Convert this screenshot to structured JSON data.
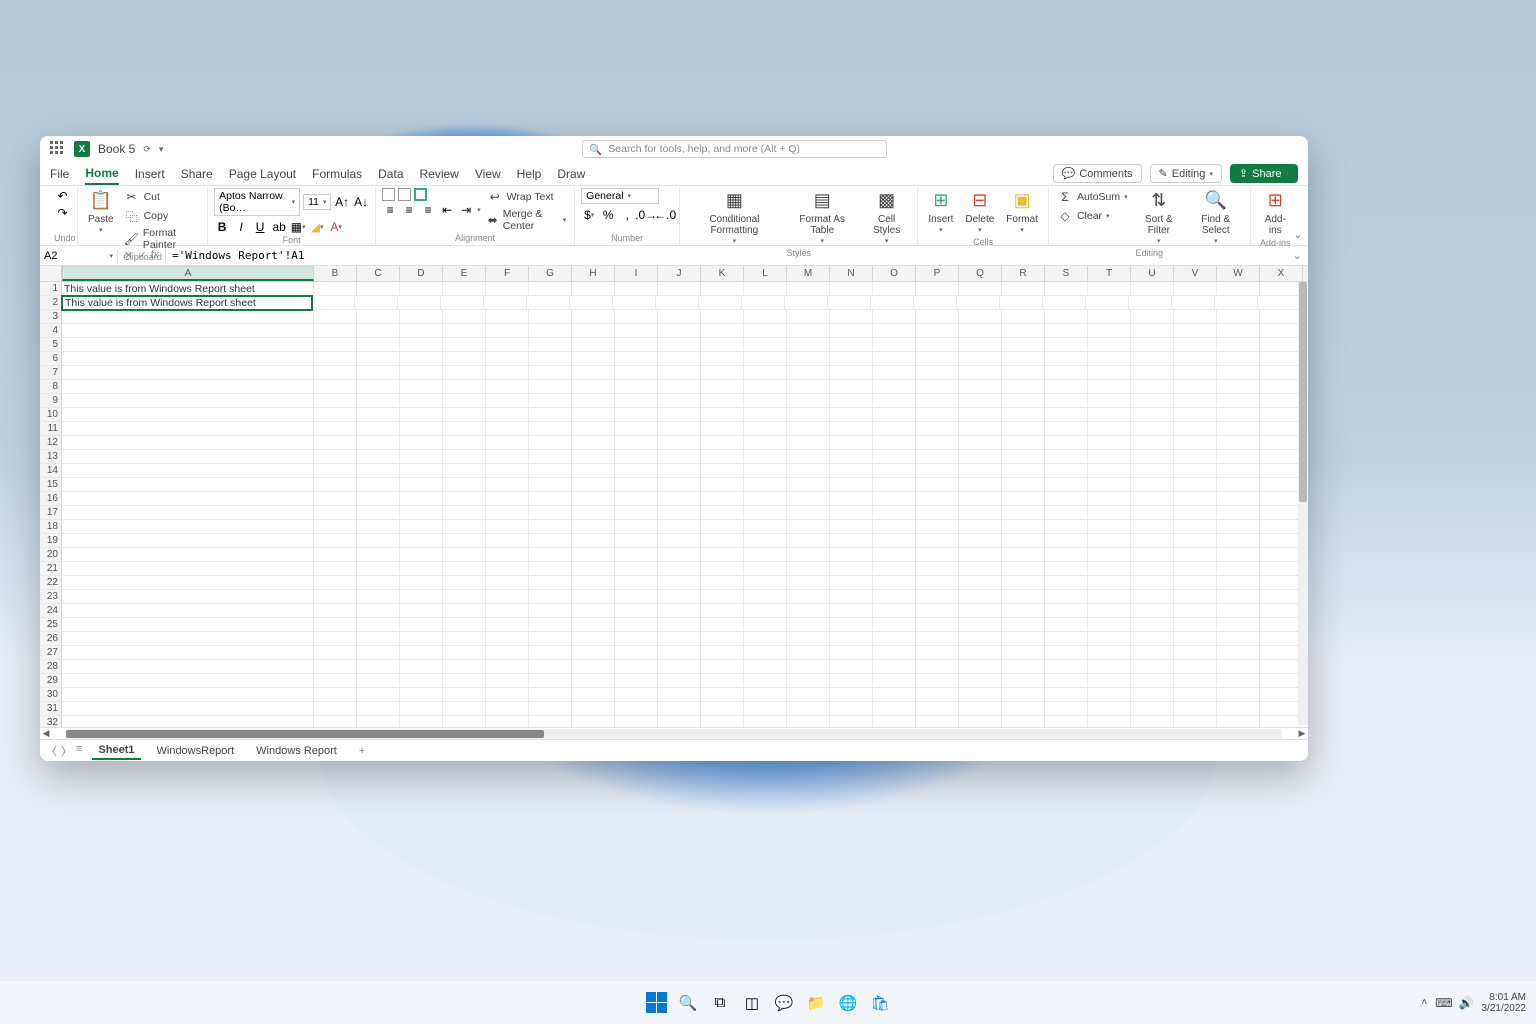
{
  "title": "Book 5",
  "search_placeholder": "Search for tools, help, and more (Alt + Q)",
  "menus": [
    "File",
    "Home",
    "Insert",
    "Share",
    "Page Layout",
    "Formulas",
    "Data",
    "Review",
    "View",
    "Help",
    "Draw"
  ],
  "active_menu": "Home",
  "right_pills": {
    "comments": "Comments",
    "editing": "Editing",
    "share": "Share"
  },
  "ribbon": {
    "undo": "Undo",
    "clipboard": {
      "paste": "Paste",
      "cut": "Cut",
      "copy": "Copy",
      "painter": "Format Painter",
      "label": "Clipboard"
    },
    "font": {
      "name": "Aptos Narrow (Bo…",
      "size": "11",
      "label": "Font"
    },
    "alignment": {
      "wrap": "Wrap Text",
      "merge": "Merge & Center",
      "label": "Alignment"
    },
    "number": {
      "format": "General",
      "label": "Number"
    },
    "styles": {
      "cond": "Conditional Formatting",
      "table": "Format As Table",
      "cell": "Cell Styles",
      "label": "Styles"
    },
    "cells": {
      "insert": "Insert",
      "delete": "Delete",
      "format": "Format",
      "label": "Cells"
    },
    "editing": {
      "autosum": "AutoSum",
      "clear": "Clear",
      "sort": "Sort & Filter",
      "find": "Find & Select",
      "label": "Editing"
    },
    "addins": {
      "btn": "Add-ins",
      "label": "Add-ins"
    }
  },
  "formula_bar": {
    "cell_ref": "A2",
    "formula": "='Windows Report'!A1"
  },
  "columns": [
    "A",
    "B",
    "C",
    "D",
    "E",
    "F",
    "G",
    "H",
    "I",
    "J",
    "K",
    "L",
    "M",
    "N",
    "O",
    "P",
    "Q",
    "R",
    "S",
    "T",
    "U",
    "V",
    "W",
    "X"
  ],
  "col_widths": {
    "A": 252,
    "default": 43
  },
  "row_count": 32,
  "active_cell": {
    "row": 2,
    "col": "A"
  },
  "cells": {
    "A1": "This value is from Windows Report sheet",
    "A2": "This value is from Windows Report sheet"
  },
  "sheet_tabs": [
    "Sheet1",
    "WindowsReport",
    "Windows Report"
  ],
  "active_sheet": "Sheet1",
  "taskbar": {
    "time": "8:01 AM",
    "date": "3/21/2022"
  }
}
